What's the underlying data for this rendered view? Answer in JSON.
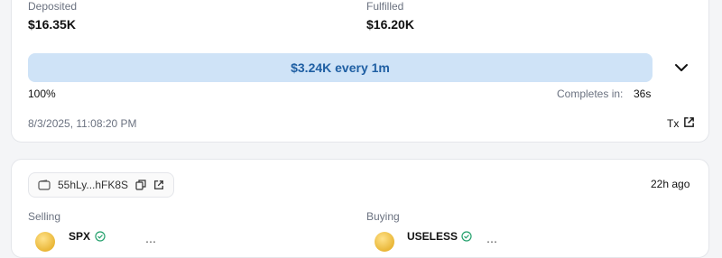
{
  "order": {
    "deposited_label": "Deposited",
    "deposited_value": "$16.35K",
    "fulfilled_label": "Fulfilled",
    "fulfilled_value": "$16.20K",
    "progress_text": "$3.24K every 1m",
    "progress_fraction": 1.0,
    "percent": "100%",
    "completes_label": "Completes in:",
    "completes_value": "36s",
    "timestamp": "8/3/2025, 11:08:20 PM",
    "tx_label": "Tx"
  },
  "order2": {
    "wallet": "55hLy...hFK8S",
    "time_ago": "22h ago",
    "selling_label": "Selling",
    "buying_label": "Buying",
    "sell_token": "SPX",
    "buy_token": "USELESS"
  },
  "colors": {
    "progress_bar": "#cfe3f7",
    "progress_text": "#1f5fa3",
    "verified": "#22a06b"
  }
}
